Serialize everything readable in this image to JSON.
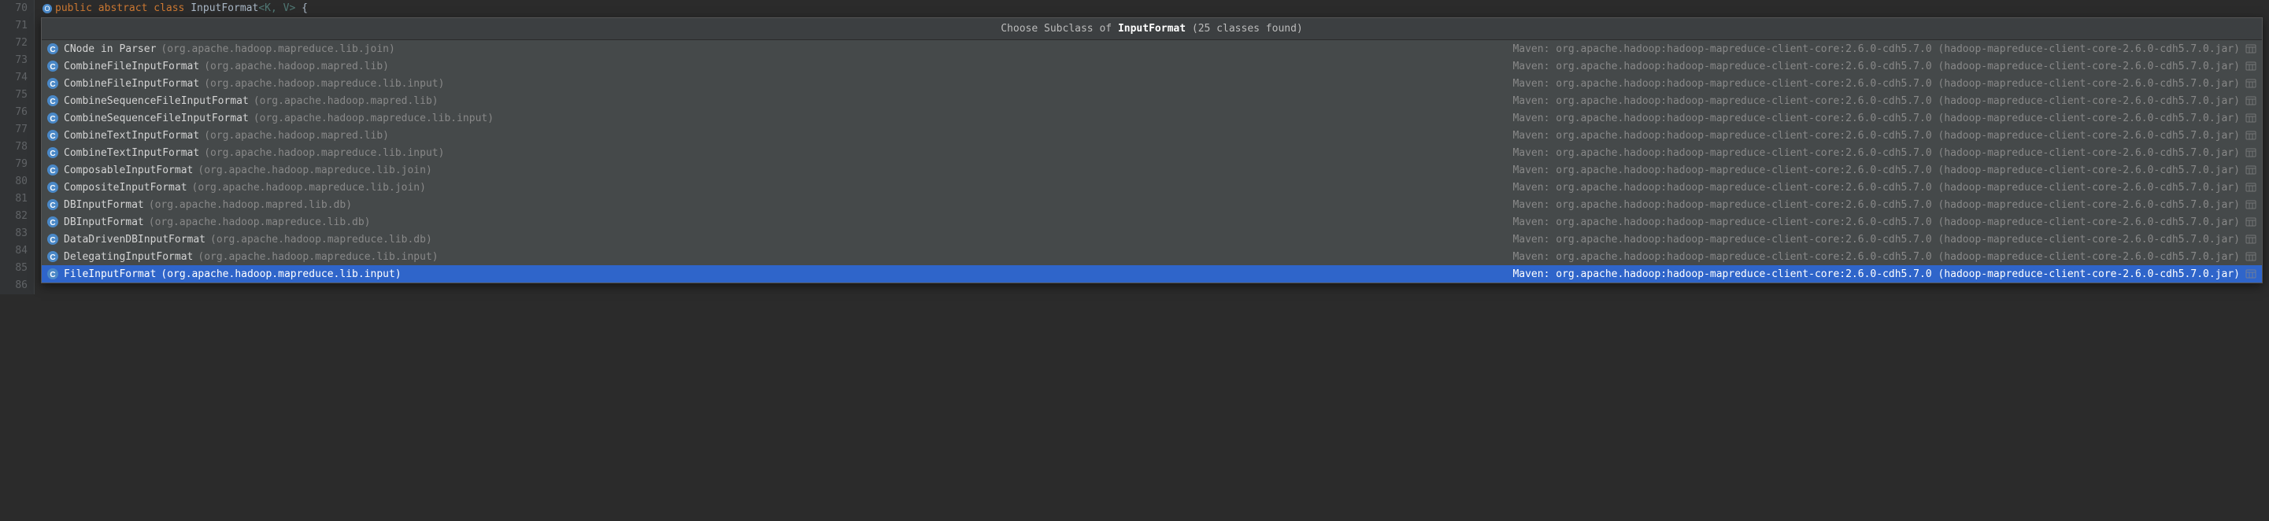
{
  "gutter": {
    "start": 70,
    "end": 86
  },
  "code": {
    "prefix_kw1": "public",
    "prefix_kw2": "abstract",
    "prefix_kw3": "class",
    "class_name": "InputFormat",
    "generics": "<K, V>",
    "brace": " {"
  },
  "popup": {
    "title_prefix": "Choose Subclass of ",
    "title_bold": "InputFormat",
    "title_suffix": " (25 classes found)",
    "maven_text": "Maven: org.apache.hadoop:hadoop-mapreduce-client-core:2.6.0-cdh5.7.0 (hadoop-mapreduce-client-core-2.6.0-cdh5.7.0.jar)",
    "items": [
      {
        "name": "CNode in Parser",
        "pkg": "(org.apache.hadoop.mapreduce.lib.join)",
        "selected": false
      },
      {
        "name": "CombineFileInputFormat",
        "pkg": "(org.apache.hadoop.mapred.lib)",
        "selected": false
      },
      {
        "name": "CombineFileInputFormat",
        "pkg": "(org.apache.hadoop.mapreduce.lib.input)",
        "selected": false
      },
      {
        "name": "CombineSequenceFileInputFormat",
        "pkg": "(org.apache.hadoop.mapred.lib)",
        "selected": false
      },
      {
        "name": "CombineSequenceFileInputFormat",
        "pkg": "(org.apache.hadoop.mapreduce.lib.input)",
        "selected": false
      },
      {
        "name": "CombineTextInputFormat",
        "pkg": "(org.apache.hadoop.mapred.lib)",
        "selected": false
      },
      {
        "name": "CombineTextInputFormat",
        "pkg": "(org.apache.hadoop.mapreduce.lib.input)",
        "selected": false
      },
      {
        "name": "ComposableInputFormat",
        "pkg": "(org.apache.hadoop.mapreduce.lib.join)",
        "selected": false
      },
      {
        "name": "CompositeInputFormat",
        "pkg": "(org.apache.hadoop.mapreduce.lib.join)",
        "selected": false
      },
      {
        "name": "DBInputFormat",
        "pkg": "(org.apache.hadoop.mapred.lib.db)",
        "selected": false
      },
      {
        "name": "DBInputFormat",
        "pkg": "(org.apache.hadoop.mapreduce.lib.db)",
        "selected": false
      },
      {
        "name": "DataDrivenDBInputFormat",
        "pkg": "(org.apache.hadoop.mapreduce.lib.db)",
        "selected": false
      },
      {
        "name": "DelegatingInputFormat",
        "pkg": "(org.apache.hadoop.mapreduce.lib.input)",
        "selected": false
      },
      {
        "name": "FileInputFormat",
        "pkg": "(org.apache.hadoop.mapreduce.lib.input)",
        "selected": true
      }
    ]
  }
}
